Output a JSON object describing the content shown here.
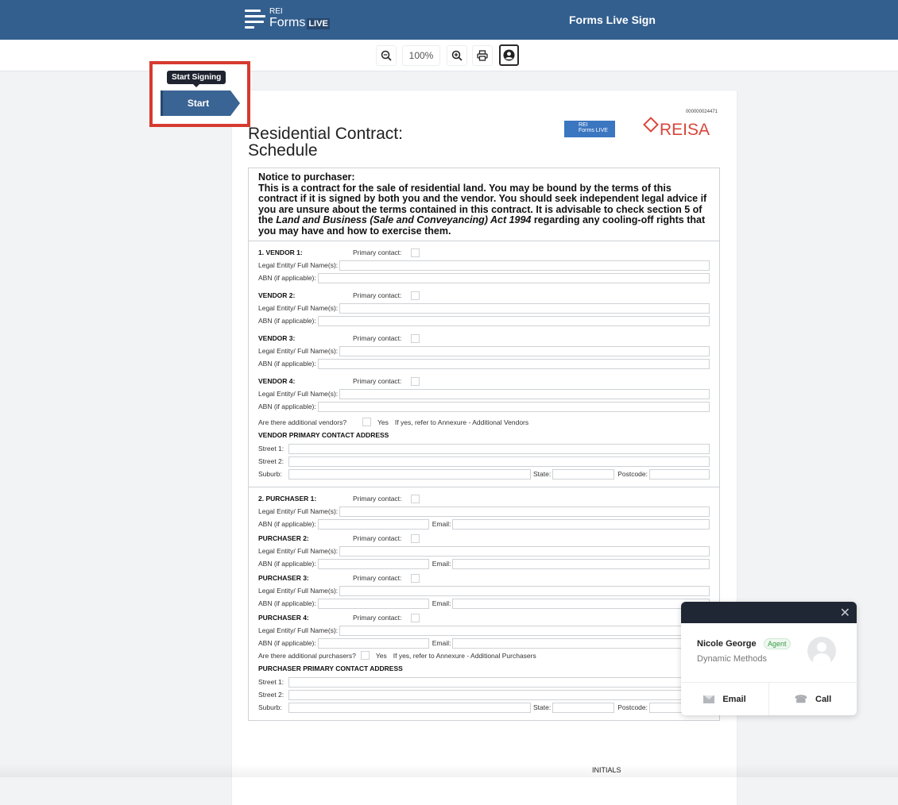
{
  "header": {
    "brand_rei": "REI",
    "brand_forms": "Forms",
    "brand_live": "LIVE",
    "app_title": "Forms Live Sign"
  },
  "toolbar": {
    "zoom_out": "zoom-out",
    "zoom_level": "100%",
    "zoom_in": "zoom-in",
    "print": "print",
    "profile": "profile"
  },
  "signing": {
    "tooltip": "Start Signing",
    "start_label": "Start"
  },
  "document": {
    "doc_number": "000000024471",
    "title_line1": "Residential Contract:",
    "title_line2": "Schedule",
    "mini_logo_rei": "REI",
    "mini_logo_forms": "Forms LIVE",
    "partner_logo": "REISA",
    "notice_heading": "Notice to purchaser:",
    "notice_text_1": "This is a contract for the sale of residential land. You may be bound by the terms of this contract if it is signed by both you and the vendor. You should seek independent legal advice if you are unsure about the terms contained in this contract.  It is advisable to check section 5 of the ",
    "notice_italic": "Land and Business (Sale and Conveyancing) Act 1994",
    "notice_text_2": " regarding any cooling-off rights that you may have and how to exercise them.",
    "labels": {
      "primary_contact": "Primary contact:",
      "legal_entity": "Legal Entity/ Full Name(s):",
      "abn": "ABN (if applicable):",
      "email": "Email:",
      "yes": "Yes",
      "street1": "Street 1:",
      "street2": "Street 2:",
      "suburb": "Suburb:",
      "state": "State:",
      "postcode": "Postcode:"
    },
    "vendors": [
      {
        "heading": "1. VENDOR 1:"
      },
      {
        "heading": "VENDOR 2:"
      },
      {
        "heading": "VENDOR 3:"
      },
      {
        "heading": "VENDOR 4:"
      }
    ],
    "additional_vendors_q": "Are there additional vendors?",
    "additional_vendors_note": "If yes, refer to Annexure - Additional Vendors",
    "vendor_address_title": "VENDOR PRIMARY CONTACT ADDRESS",
    "purchasers": [
      {
        "heading": "2. PURCHASER 1:"
      },
      {
        "heading": "PURCHASER 2:"
      },
      {
        "heading": "PURCHASER 3:"
      },
      {
        "heading": "PURCHASER 4:"
      }
    ],
    "additional_purchasers_q": "Are there additional purchasers?",
    "additional_purchasers_note": "If yes, refer to Annexure - Additional Purchasers",
    "purchaser_address_title": "PURCHASER PRIMARY CONTACT ADDRESS",
    "initials_label": "INITIALS"
  },
  "contact_card": {
    "name": "Nicole George",
    "badge": "Agent",
    "company": "Dynamic Methods",
    "email_label": "Email",
    "call_label": "Call"
  }
}
